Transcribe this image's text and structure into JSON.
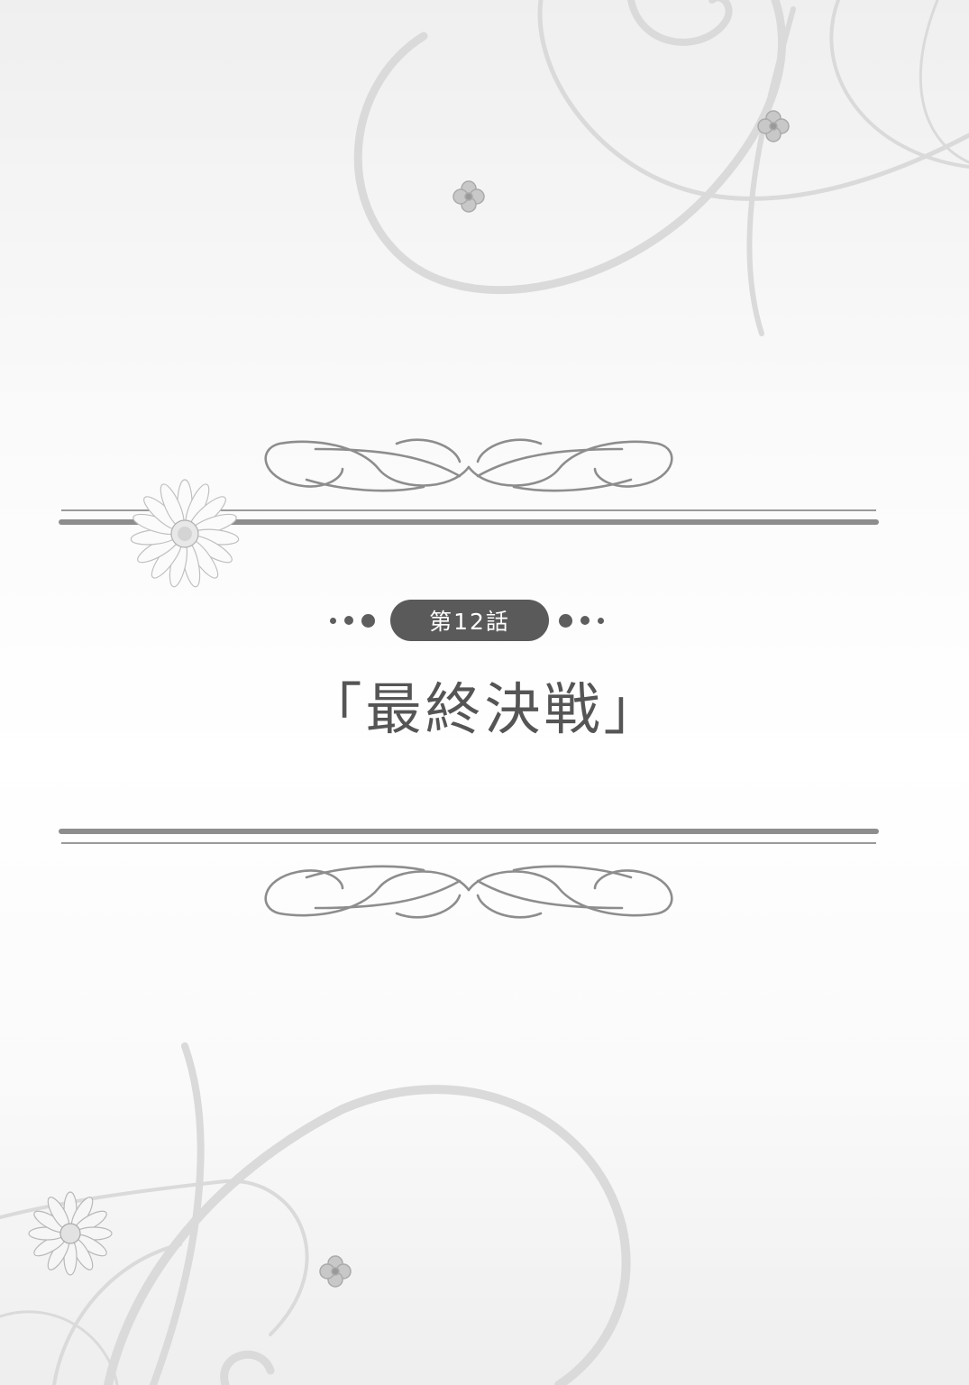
{
  "chapter": {
    "label": "第12話"
  },
  "title": {
    "text": "「最終決戦」"
  },
  "colors": {
    "ink": "#555555",
    "pill": "#5a5a5a",
    "rule": "#8d8d8d",
    "swirl": "#dcdcdc"
  },
  "icons": [
    "daisy-icon",
    "small-flower-icon",
    "flourish-icon"
  ]
}
